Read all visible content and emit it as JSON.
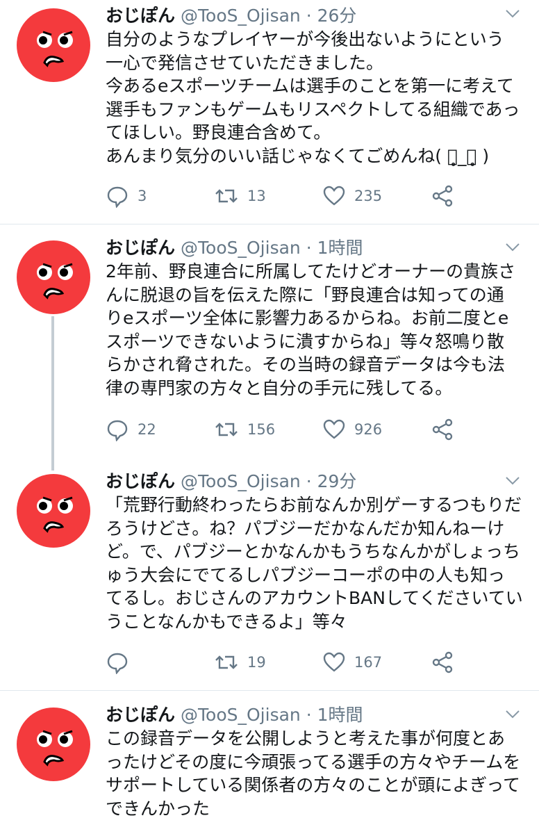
{
  "colors": {
    "accent": "#1da1f2",
    "muted": "#657786",
    "avatar": "#f43a3d"
  },
  "tweets": [
    {
      "display_name": "おじぽん",
      "handle": "@TooS_Ojisan",
      "separator": "·",
      "time": "26分",
      "text": "自分のようなプレイヤーが今後出ないようにという\n一心で発信させていただきました。\n今あるeスポーツチームは選手のことを第一に考えて\n選手もファンもゲームもリスペクトしてる組織であっ\nてほしい。野良連合含めて。\nあんまり気分のいい話じゃなくてごめんね( ･̥_･̥ )",
      "replies": "3",
      "retweets": "13",
      "likes": "235"
    },
    {
      "display_name": "おじぽん",
      "handle": "@TooS_Ojisan",
      "separator": "·",
      "time": "1時間",
      "text": "2年前、野良連合に所属してたけどオーナーの貴族さ\nんに脱退の旨を伝えた際に「野良連合は知っての通\nりeスポーツ全体に影響力あるからね。お前二度とe\nスポーツできないように潰すからね」等々怒鳴り散\nらかされ脅された。その当時の録音データは今も法\n律の専門家の方々と自分の手元に残してる。",
      "replies": "22",
      "retweets": "156",
      "likes": "926"
    },
    {
      "display_name": "おじぽん",
      "handle": "@TooS_Ojisan",
      "separator": "·",
      "time": "29分",
      "text": "「荒野行動終わったらお前なんか別ゲーするつもりだ\nろうけどさ。ね？パブジーだかなんだか知んねーけ\nど。で、パブジーとかなんかもうちなんかがしょっち\nゅう大会にでてるしパブジーコーポの中の人も知っ\nてるし。おじさんのアカウントBANしてくださいてい\nうことなんかもできるよ」等々",
      "replies": "",
      "retweets": "19",
      "likes": "167"
    },
    {
      "display_name": "おじぽん",
      "handle": "@TooS_Ojisan",
      "separator": "·",
      "time": "1時間",
      "text": "この録音データを公開しようと考えた事が何度とあ\nったけどその度に今頑張ってる選手の方々やチームを\nサポートしている関係者の方々のことが頭によぎって\nできんかった"
    }
  ]
}
